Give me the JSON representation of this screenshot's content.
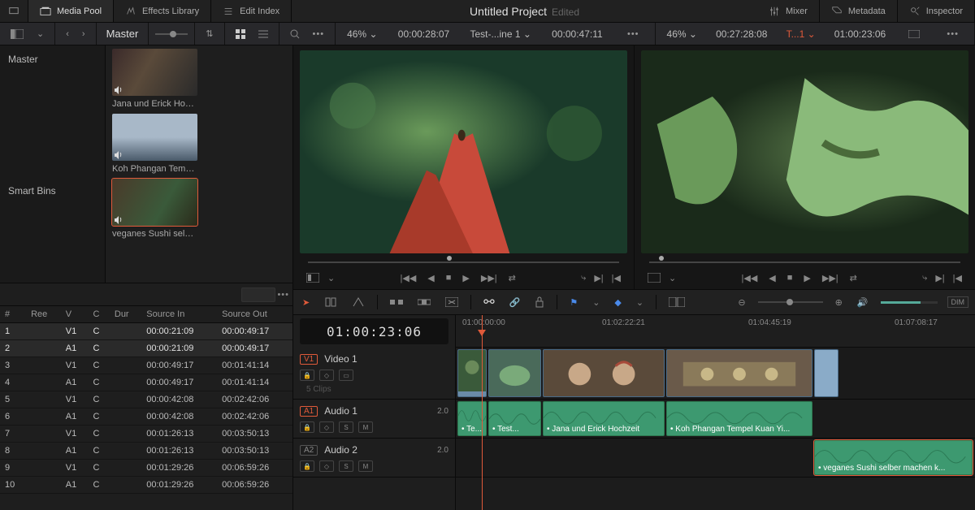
{
  "topbar": {
    "tabs": [
      {
        "id": "media-pool",
        "label": "Media Pool",
        "active": true
      },
      {
        "id": "effects",
        "label": "Effects Library"
      },
      {
        "id": "edit-index",
        "label": "Edit Index"
      }
    ],
    "title": "Untitled Project",
    "edited": "Edited",
    "right_tabs": [
      {
        "id": "mixer",
        "label": "Mixer"
      },
      {
        "id": "metadata",
        "label": "Metadata"
      },
      {
        "id": "inspector",
        "label": "Inspector"
      }
    ]
  },
  "subbar": {
    "master": "Master",
    "viewer_a": {
      "zoom": "46%",
      "tc": "00:00:28:07",
      "clip": "Test-...ine 1",
      "dur": "00:00:47:11"
    },
    "viewer_b": {
      "zoom": "46%",
      "tc": "00:27:28:08",
      "clip": "T...1",
      "dur": "01:00:23:06"
    }
  },
  "bins": {
    "items": [
      "Master",
      "",
      "",
      "",
      "",
      "",
      "",
      "Smart Bins"
    ]
  },
  "pool": {
    "clips": [
      {
        "label": "Jana und Erick Hochz...",
        "sel": false
      },
      {
        "label": "Koh Phangan Tempel...",
        "sel": false
      },
      {
        "label": "veganes Sushi selber...",
        "sel": true
      }
    ]
  },
  "edit_table": {
    "cols": [
      "#",
      "Ree",
      "V",
      "C",
      "Dur",
      "Source In",
      "Source Out"
    ],
    "rows": [
      {
        "n": "1",
        "v": "V1",
        "c": "C",
        "in": "00:00:21:09",
        "out": "00:00:49:17",
        "sel": true
      },
      {
        "n": "2",
        "v": "A1",
        "c": "C",
        "in": "00:00:21:09",
        "out": "00:00:49:17",
        "sel": true
      },
      {
        "n": "3",
        "v": "V1",
        "c": "C",
        "in": "00:00:49:17",
        "out": "00:01:41:14"
      },
      {
        "n": "4",
        "v": "A1",
        "c": "C",
        "in": "00:00:49:17",
        "out": "00:01:41:14"
      },
      {
        "n": "5",
        "v": "V1",
        "c": "C",
        "in": "00:00:42:08",
        "out": "00:02:42:06"
      },
      {
        "n": "6",
        "v": "A1",
        "c": "C",
        "in": "00:00:42:08",
        "out": "00:02:42:06"
      },
      {
        "n": "7",
        "v": "V1",
        "c": "C",
        "in": "00:01:26:13",
        "out": "00:03:50:13"
      },
      {
        "n": "8",
        "v": "A1",
        "c": "C",
        "in": "00:01:26:13",
        "out": "00:03:50:13"
      },
      {
        "n": "9",
        "v": "V1",
        "c": "C",
        "in": "00:01:29:26",
        "out": "00:06:59:26"
      },
      {
        "n": "10",
        "v": "A1",
        "c": "C",
        "in": "00:01:29:26",
        "out": "00:06:59:26"
      }
    ]
  },
  "timeline": {
    "tc": "01:00:23:06",
    "ruler": [
      "01:00:00:00",
      "01:02:22:21",
      "01:04:45:19",
      "01:07:08:17"
    ],
    "video_track": {
      "tag": "V1",
      "name": "Video 1",
      "clips_label": "5 Clips"
    },
    "audio1": {
      "tag": "A1",
      "name": "Audio 1",
      "db": "2.0",
      "clips": [
        {
          "label": "• Te..."
        },
        {
          "label": "• Test..."
        },
        {
          "label": "• Jana und Erick Hochzeit"
        },
        {
          "label": "• Koh Phangan Tempel Kuan Yi..."
        }
      ]
    },
    "audio2": {
      "tag": "A2",
      "name": "Audio 2",
      "db": "2.0",
      "clips": [
        {
          "label": "• veganes Sushi selber machen k..."
        }
      ]
    },
    "dim": "DIM"
  }
}
